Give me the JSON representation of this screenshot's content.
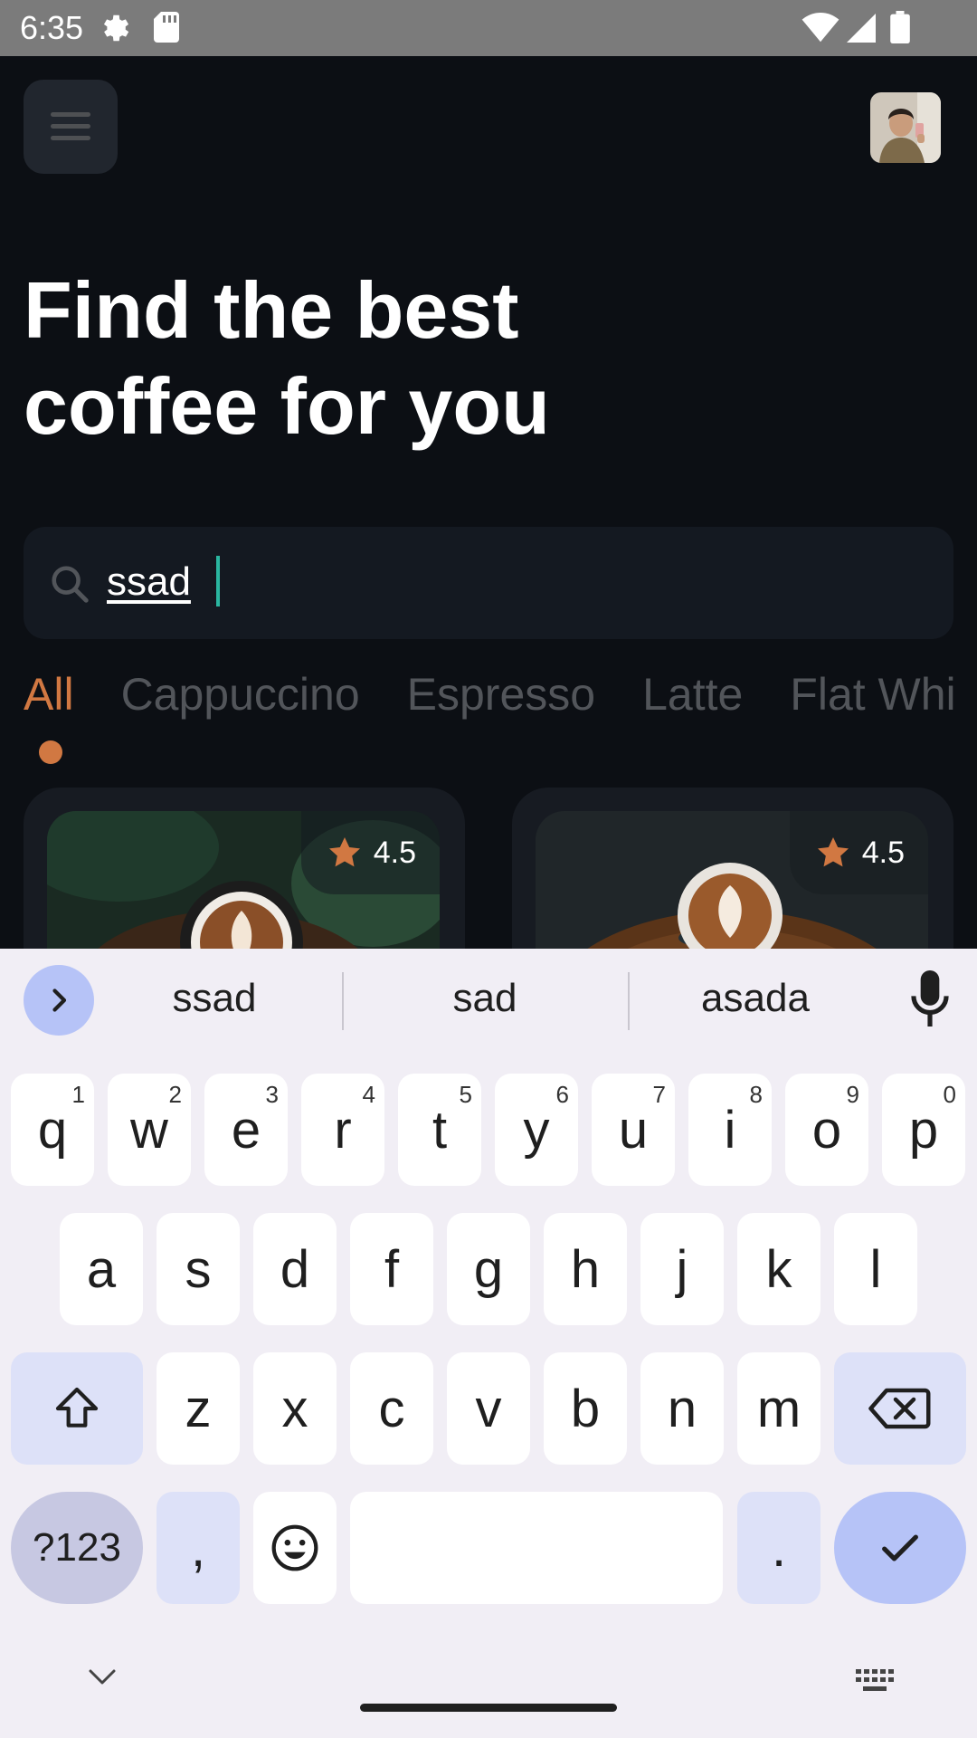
{
  "status_bar": {
    "time": "6:35"
  },
  "header": {
    "headline_line1": "Find the best",
    "headline_line2": "coffee for you"
  },
  "search": {
    "value": "ssad"
  },
  "tabs": [
    {
      "label": "All",
      "active": true
    },
    {
      "label": "Cappuccino",
      "active": false
    },
    {
      "label": "Espresso",
      "active": false
    },
    {
      "label": "Latte",
      "active": false
    },
    {
      "label": "Flat White",
      "active": false
    }
  ],
  "cards": [
    {
      "rating": "4.5"
    },
    {
      "rating": "4.5"
    }
  ],
  "colors": {
    "accent": "#d17842",
    "background": "#0c0f14",
    "surface": "#141921"
  },
  "keyboard": {
    "suggestions": [
      "ssad",
      "sad",
      "asada"
    ],
    "row1": [
      {
        "k": "q",
        "h": "1"
      },
      {
        "k": "w",
        "h": "2"
      },
      {
        "k": "e",
        "h": "3"
      },
      {
        "k": "r",
        "h": "4"
      },
      {
        "k": "t",
        "h": "5"
      },
      {
        "k": "y",
        "h": "6"
      },
      {
        "k": "u",
        "h": "7"
      },
      {
        "k": "i",
        "h": "8"
      },
      {
        "k": "o",
        "h": "9"
      },
      {
        "k": "p",
        "h": "0"
      }
    ],
    "row2": [
      "a",
      "s",
      "d",
      "f",
      "g",
      "h",
      "j",
      "k",
      "l"
    ],
    "row3": [
      "z",
      "x",
      "c",
      "v",
      "b",
      "n",
      "m"
    ],
    "symbols_label": "?123",
    "comma": ",",
    "period": "."
  }
}
